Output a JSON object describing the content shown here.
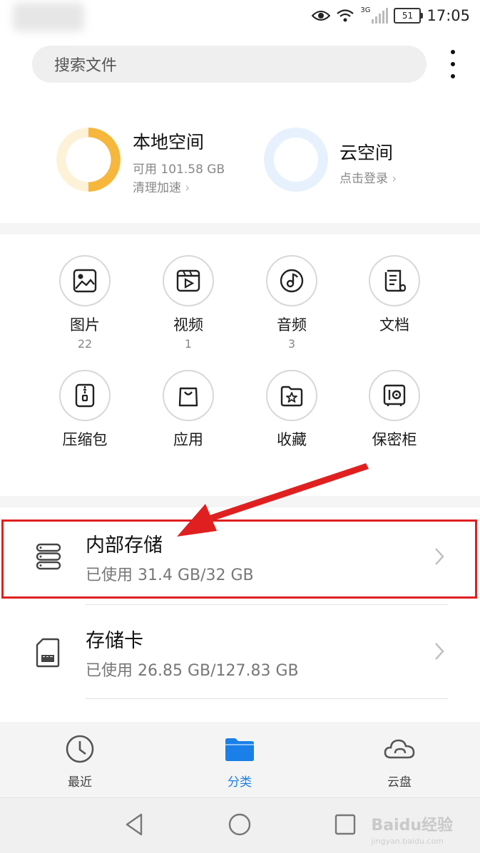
{
  "status_bar": {
    "time": "17:05",
    "battery": "51",
    "network": "3G"
  },
  "search": {
    "placeholder": "搜索文件"
  },
  "local_space": {
    "title": "本地空间",
    "available": "可用 101.58 GB",
    "cleanup": "清理加速",
    "used_fraction": 0.5,
    "color": "#f6b73c",
    "track_color": "#fdf1d8"
  },
  "cloud_space": {
    "title": "云空间",
    "login": "点击登录"
  },
  "categories": [
    {
      "label": "图片",
      "count": "22",
      "icon": "image-icon"
    },
    {
      "label": "视频",
      "count": "1",
      "icon": "video-icon"
    },
    {
      "label": "音频",
      "count": "3",
      "icon": "music-disc-icon"
    },
    {
      "label": "文档",
      "count": "",
      "icon": "document-scroll-icon"
    },
    {
      "label": "压缩包",
      "count": "",
      "icon": "zip-icon"
    },
    {
      "label": "应用",
      "count": "",
      "icon": "shopping-bag-icon"
    },
    {
      "label": "收藏",
      "count": "",
      "icon": "star-folder-icon"
    },
    {
      "label": "保密柜",
      "count": "",
      "icon": "safe-icon"
    }
  ],
  "storage": {
    "internal": {
      "title": "内部存储",
      "usage": "已使用 31.4 GB/32 GB"
    },
    "sd_card": {
      "title": "存储卡",
      "usage": "已使用 26.85 GB/127.83 GB"
    }
  },
  "bottom_nav": {
    "recent": "最近",
    "categories": "分类",
    "cloud": "云盘",
    "active_color": "#1a7fe8"
  },
  "watermark": {
    "text": "Baidu经验",
    "url": "jingyan.baidu.com"
  }
}
